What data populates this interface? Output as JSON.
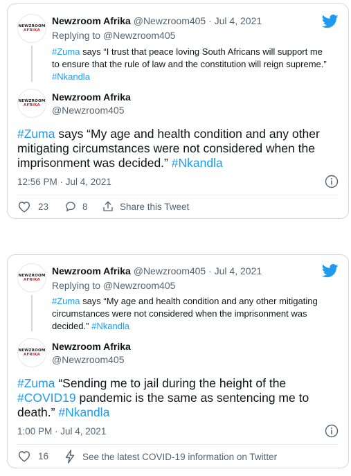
{
  "colors": {
    "accent": "#1d9bf0",
    "muted": "#536471",
    "border": "#cfd9de",
    "text": "#0f1419"
  },
  "avatar": {
    "logo_top": "NEWZROOM",
    "logo_bottom": "AFRIKA"
  },
  "tweets": [
    {
      "parent": {
        "name": "Newzroom Afrika",
        "meta": "@Newzroom405 · Jul 4, 2021",
        "replying_prefix": "Replying to ",
        "replying_handle": "@Newzroom405",
        "text_lines": [
          {
            "tag": "#Zuma",
            "rest": " says “I trust that peace loving South Africans will support me"
          },
          {
            "tag": "",
            "rest": "to ensure that the rule of law and the constitution will reign supreme.”"
          },
          {
            "tag": "#Nkandla",
            "rest": ""
          }
        ]
      },
      "main": {
        "name": "Newzroom Afrika",
        "handle": "@Newzroom405",
        "lines": [
          {
            "pre": "",
            "tag": "#Zuma",
            "post": " says “My age and health condition and any other"
          },
          {
            "pre": "mitigating circumstances were not considered when the",
            "tag": "",
            "post": ""
          },
          {
            "pre": "imprisonment was decided.” ",
            "tag": "#Nkandla",
            "post": ""
          }
        ],
        "timestamp": "12:56 PM · Jul 4, 2021"
      },
      "actions": {
        "likes": "23",
        "replies": "8",
        "share": "Share this Tweet"
      }
    },
    {
      "parent": {
        "name": "Newzroom Afrika",
        "meta": "@Newzroom405 · Jul 4, 2021",
        "replying_prefix": "Replying to ",
        "replying_handle": "@Newzroom405",
        "text_lines": [
          {
            "tag": "#Zuma",
            "rest": " says “My age and health condition and any other mitigating"
          },
          {
            "tag": "",
            "rest": "circumstances were not considered when the imprisonment was"
          },
          {
            "tag": "",
            "rest": "decided.” ",
            "tag2": "#Nkandla"
          }
        ]
      },
      "main": {
        "name": "Newzroom Afrika",
        "handle": "@Newzroom405",
        "lines": [
          {
            "pre": "",
            "tag": "#Zuma",
            "post": " “Sending me to jail during the height of the"
          },
          {
            "pre": "",
            "tag": "#COVID19",
            "post": " pandemic is the same as sentencing me to"
          },
          {
            "pre": "death.” ",
            "tag": "#Nkandla",
            "post": ""
          }
        ],
        "timestamp": "1:00 PM · Jul 4, 2021"
      },
      "actions": {
        "likes": "16",
        "covid": "See the latest COVID-19 information on Twitter"
      }
    }
  ]
}
